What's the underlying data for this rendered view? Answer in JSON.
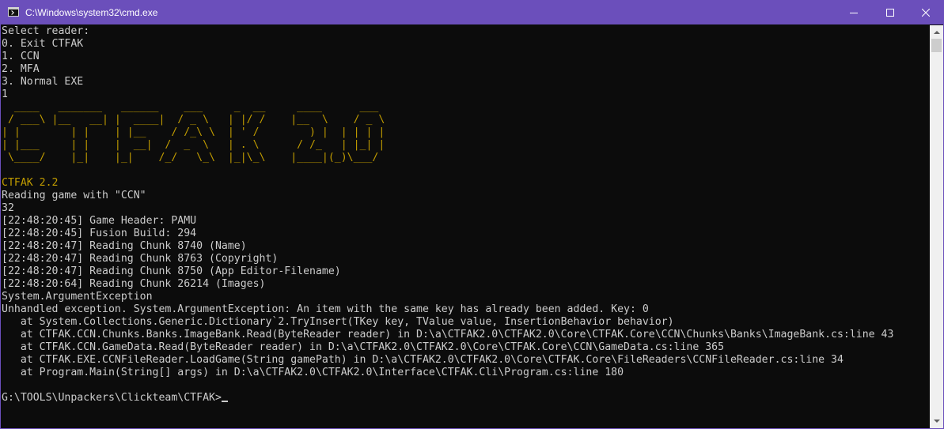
{
  "window": {
    "title": "C:\\Windows\\system32\\cmd.exe",
    "icon": "console-icon",
    "controls": {
      "minimize": "minimize-icon",
      "maximize": "maximize-icon",
      "close": "close-icon"
    }
  },
  "colors": {
    "titlebar": "#6b4fbb",
    "console_bg": "#0c0c0c",
    "text": "#cccccc",
    "gold": "#c19c00"
  },
  "console": {
    "lines": [
      "Select reader:",
      "0. Exit CTFAK",
      "1. CCN",
      "2. MFA",
      "3. Normal EXE",
      "1",
      "  ____   _______   ______    ___     _  __     ____      ___",
      " / ___\\ |__   __| |  ____|  / _ \\   | |/ /    |__  \\    / _ \\",
      "| |        | |    | |__    / /_\\ \\  | ' /        ) |  | | | |",
      "| |___     | |    |  __|  /  _  \\   | . \\      / /_   | |_| |",
      " \\____/    |_|    |_|    /_/   \\_\\  |_|\\_\\    |____|(_)\\___/",
      "",
      "CTFAK 2.2",
      "Reading game with \"CCN\"",
      "32",
      "[22:48:20:45] Game Header: PAMU",
      "[22:48:20:45] Fusion Build: 294",
      "[22:48:20:47] Reading Chunk 8740 (Name)",
      "[22:48:20:47] Reading Chunk 8763 (Copyright)",
      "[22:48:20:47] Reading Chunk 8750 (App Editor-Filename)",
      "[22:48:20:64] Reading Chunk 26214 (Images)",
      "System.ArgumentException",
      "Unhandled exception. System.ArgumentException: An item with the same key has already been added. Key: 0",
      "   at System.Collections.Generic.Dictionary`2.TryInsert(TKey key, TValue value, InsertionBehavior behavior)",
      "   at CTFAK.CCN.Chunks.Banks.ImageBank.Read(ByteReader reader) in D:\\a\\CTFAK2.0\\CTFAK2.0\\Core\\CTFAK.Core\\CCN\\Chunks\\Banks\\ImageBank.cs:line 43",
      "   at CTFAK.CCN.GameData.Read(ByteReader reader) in D:\\a\\CTFAK2.0\\CTFAK2.0\\Core\\CTFAK.Core\\CCN\\GameData.cs:line 365",
      "   at CTFAK.EXE.CCNFileReader.LoadGame(String gamePath) in D:\\a\\CTFAK2.0\\CTFAK2.0\\Core\\CTFAK.Core\\FileReaders\\CCNFileReader.cs:line 34",
      "   at Program.Main(String[] args) in D:\\a\\CTFAK2.0\\CTFAK2.0\\Interface\\CTFAK.Cli\\Program.cs:line 180",
      "",
      "G:\\TOOLS\\Unpackers\\Clickteam\\CTFAK>"
    ]
  }
}
